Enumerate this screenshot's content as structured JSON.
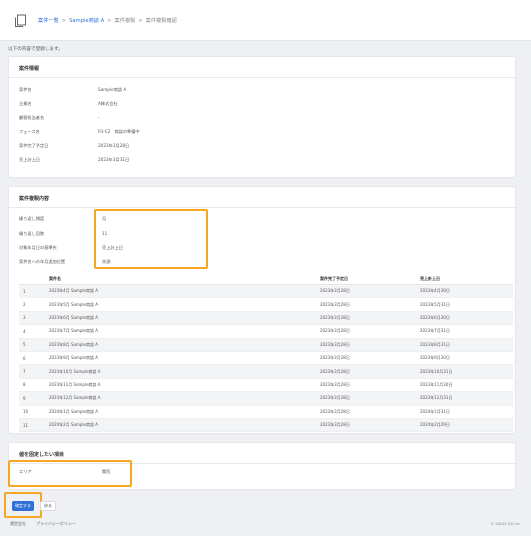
{
  "breadcrumb": {
    "items": [
      "案件一覧",
      "Sample商談 A",
      "案件複製",
      "案件複製確認"
    ]
  },
  "intro_text": "以下の内容で登録します。",
  "project_info": {
    "title": "案件情報",
    "rows": [
      {
        "label": "案件名",
        "value": "Sample商談 A"
      },
      {
        "label": "企業名",
        "value": "A株式会社"
      },
      {
        "label": "顧客担当者名",
        "value": "-"
      },
      {
        "label": "フェーズ名",
        "value": "P3-C2　商談の準備中"
      },
      {
        "label": "案件完了予定日",
        "value": "2023年3月28日"
      },
      {
        "label": "売上計上日",
        "value": "2023年3月31日"
      }
    ]
  },
  "replication": {
    "title": "案件複製内容",
    "rows": [
      {
        "label": "繰り返し頻度",
        "value": "月"
      },
      {
        "label": "繰り返し回数",
        "value": "11"
      },
      {
        "label": "対象年月日の基準先",
        "value": "売上計上日"
      },
      {
        "label": "案件名への年月追加位置",
        "value": "先頭"
      }
    ],
    "table": {
      "headers": [
        "",
        "案件名",
        "案件完了予定日",
        "売上計上日"
      ],
      "rows": [
        [
          "1",
          "2023年4月 Sample商談 A",
          "2023年3月28日",
          "2023年4月30日"
        ],
        [
          "2",
          "2023年5月 Sample商談 A",
          "2023年3月28日",
          "2023年5月31日"
        ],
        [
          "3",
          "2023年6月 Sample商談 A",
          "2023年3月28日",
          "2023年6月30日"
        ],
        [
          "4",
          "2023年7月 Sample商談 A",
          "2023年3月28日",
          "2023年7月31日"
        ],
        [
          "5",
          "2023年8月 Sample商談 A",
          "2023年3月28日",
          "2023年8月31日"
        ],
        [
          "6",
          "2023年9月 Sample商談 A",
          "2023年3月28日",
          "2023年9月30日"
        ],
        [
          "7",
          "2023年10月 Sample商談 A",
          "2023年3月28日",
          "2023年10月31日"
        ],
        [
          "8",
          "2023年11月 Sample商談 A",
          "2023年3月28日",
          "2023年11月30日"
        ],
        [
          "9",
          "2023年12月 Sample商談 A",
          "2023年3月28日",
          "2023年12月31日"
        ],
        [
          "10",
          "2024年1月 Sample商談 A",
          "2023年3月28日",
          "2024年1月31日"
        ],
        [
          "11",
          "2024年2月 Sample商談 A",
          "2023年3月28日",
          "2024年2月29日"
        ]
      ]
    }
  },
  "fixed_values": {
    "title": "値を固定したい項目",
    "rows": [
      {
        "label": "エリア",
        "value": "関西"
      }
    ]
  },
  "actions": {
    "confirm_label": "確定する",
    "back_label": "戻る"
  },
  "footer": {
    "terms": "運営会社",
    "privacy": "プライバシーポリシー",
    "copyright": "© SALES GO Inc."
  },
  "colors": {
    "accent": "#2f6fd6",
    "highlight": "#f5a623"
  }
}
